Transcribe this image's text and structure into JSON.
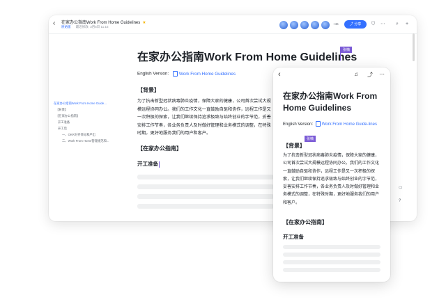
{
  "header": {
    "doc_title": "在家办公指南Work From Home Guidelines",
    "workspace_tag": "原始版",
    "last_modified": "最近修改: 3月5日 11:15",
    "share_label": "分享",
    "collaborator_count": "+46"
  },
  "outline": {
    "items": [
      "在家办公指南Work From Home Guide...",
      "【背景】",
      "【在家办公指南】",
      "开工准备",
      "开工后",
      "一、OKR对齐目标和产出",
      "二、Work From Home管理规范和..."
    ]
  },
  "document": {
    "title": "在家办公指南Work From Home Guidelines",
    "cursor_user": "张楠",
    "english_version_label": "English Version:",
    "english_version_link": "Work From Home Guidelines",
    "section_background": "【背景】",
    "background_paragraph": "为了抗击新型冠状病毒肺炎疫情，保障大家的健康，公司首次尝试大规模远程协同办公。我们的工作文化一直鼓励自驱和协作，远程工作是又一次积极的探索，让我们继续保持追求极致与始终创业的字节范，妥善安排工作节奏，各业务负责人及时做好管理和业务模式的调整，在特殊时期，更好地服务我们的用户和客户。",
    "section_guide": "【在家办公指南】",
    "section_start": "开工准备"
  },
  "mobile": {
    "title": "在家办公指南Work From Home Guidelines",
    "english_version_label": "English Version:",
    "english_version_link": "Work From Home Guide-lines",
    "cursor_user": "张楠",
    "section_background": "【背景】",
    "background_paragraph": "为了抗击新型冠状病毒肺炎疫情，保障大家的健康，公司首次尝试大规模远程协同办公。我们的工作文化一直鼓励自驱和协作，远程工作是又一次积极的探索，让我们继续保持追求极致与始终创业的字节范，妥善安排工作节奏，各业务负责人及时做好管理和业务模式的调整，在特殊时期，更好地服务我们的用户和客户。",
    "section_guide": "【在家办公指南】",
    "section_start": "开工准备"
  },
  "colors": {
    "accent": "#3370ff",
    "cursor": "#7b5bd6",
    "star": "#f5b400"
  }
}
